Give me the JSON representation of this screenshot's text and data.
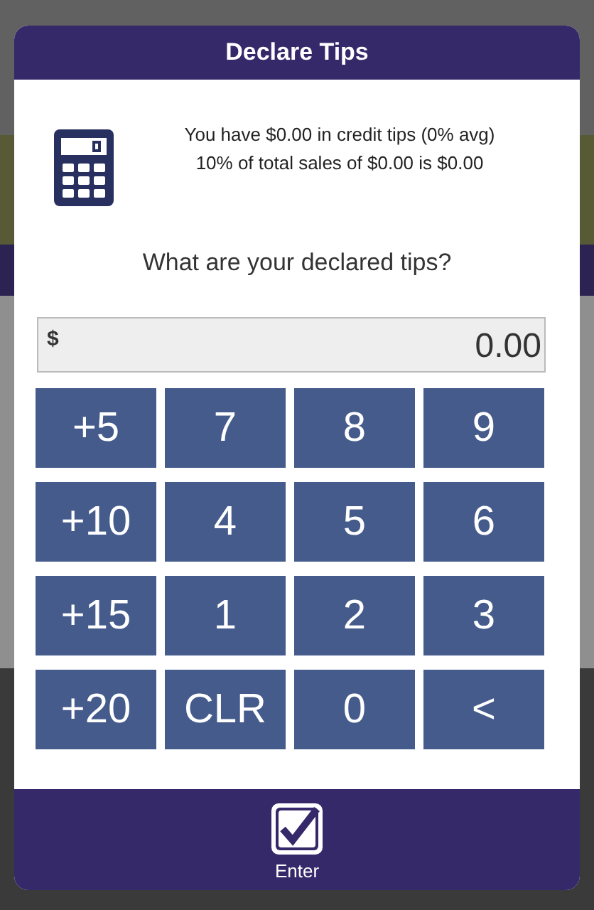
{
  "dialog": {
    "title": "Declare Tips"
  },
  "summary": [
    "You have $0.00 in credit tips (0% avg)",
    "10% of total sales of $0.00 is $0.00"
  ],
  "question": "What are your declared tips?",
  "amount_field": {
    "currency": "$",
    "value": "0.00"
  },
  "keys": [
    "+5",
    "7",
    "8",
    "9",
    "+10",
    "4",
    "5",
    "6",
    "+15",
    "1",
    "2",
    "3",
    "+20",
    "CLR",
    "0",
    "<"
  ],
  "footer": {
    "enter": {
      "label": "Enter",
      "checked": true
    }
  }
}
